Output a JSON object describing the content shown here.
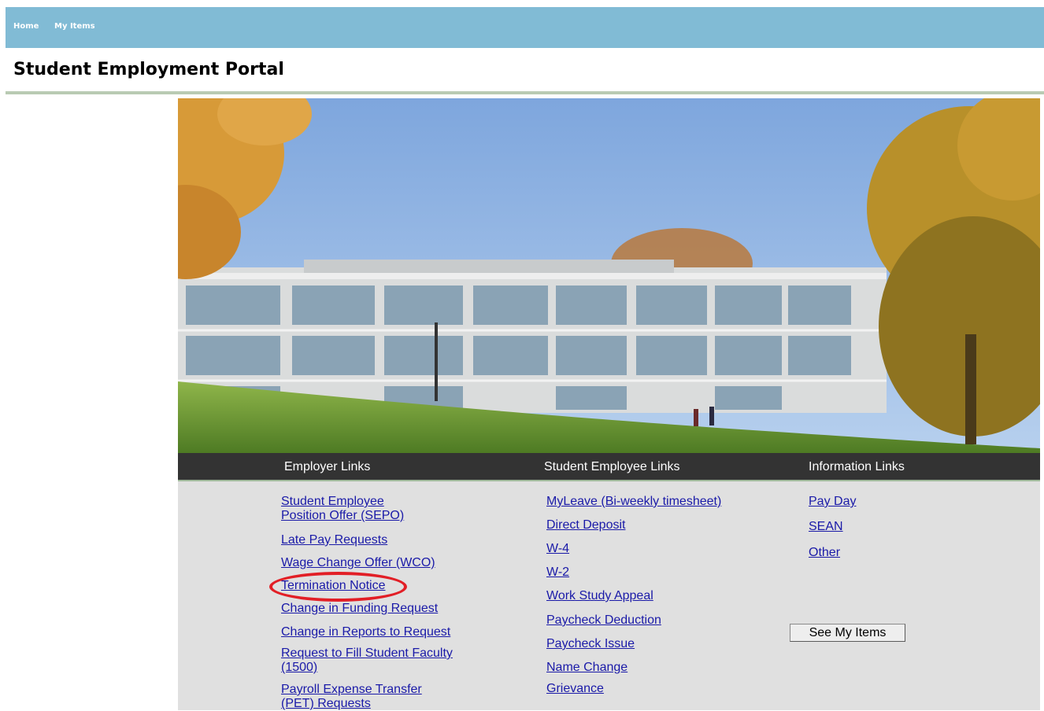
{
  "nav": {
    "home_label": "Home",
    "my_items_label": "My Items"
  },
  "page": {
    "title": "Student Employment Portal"
  },
  "hero": {
    "image": "campus-building-photo"
  },
  "sections": {
    "employer": {
      "heading": "Employer Links",
      "links": [
        {
          "line1": "Student Employee",
          "line2": "Position Offer (SEPO)"
        },
        {
          "line1": "Late Pay Requests"
        },
        {
          "line1": "Wage Change Offer (WCO)"
        },
        {
          "line1": "Termination Notice"
        },
        {
          "line1": "Change in Funding Request"
        },
        {
          "line1": "Change in Reports to Request"
        },
        {
          "line1": "Request to Fill Student Faculty",
          "line2": "(1500)"
        },
        {
          "line1": "Payroll Expense Transfer",
          "line2": "(PET) Requests"
        }
      ]
    },
    "student": {
      "heading": "Student Employee Links",
      "links": [
        {
          "label": "MyLeave (Bi-weekly timesheet)"
        },
        {
          "label": "Direct Deposit"
        },
        {
          "label": "W-4"
        },
        {
          "label": "W-2"
        },
        {
          "label": "Work Study Appeal"
        },
        {
          "label": "Paycheck Deduction"
        },
        {
          "label": "Paycheck Issue"
        },
        {
          "label": "Name Change"
        },
        {
          "label": "Grievance"
        }
      ]
    },
    "info": {
      "heading": "Information Links",
      "links": [
        {
          "label": "Pay Day"
        },
        {
          "label": "SEAN"
        },
        {
          "label": "Other"
        }
      ],
      "button_label": "See My Items"
    }
  },
  "colors": {
    "nav_bar": "#81bbd5",
    "link": "#1a1aa8",
    "header_bar": "#333333",
    "panel": "#e0e0e0",
    "annotation": "#e21f26"
  }
}
